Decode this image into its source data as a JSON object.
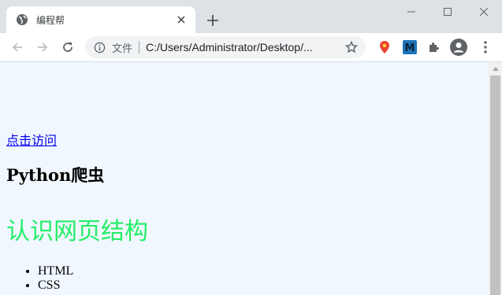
{
  "window": {
    "controls": [
      "minimize",
      "maximize",
      "close"
    ]
  },
  "tab": {
    "title": "编程帮",
    "favicon": "globe-icon"
  },
  "toolbar": {
    "omnibox_label": "文件",
    "url": "C:/Users/Administrator/Desktop/..."
  },
  "page": {
    "link_text": "点击访问",
    "heading_small": "Python爬虫",
    "heading_large": "认识网页结构",
    "heading_large_color": "#22ee66",
    "list_items": [
      "HTML",
      "CSS"
    ]
  },
  "colors": {
    "page_background": "#f0f7ff",
    "link": "#0000ee"
  }
}
